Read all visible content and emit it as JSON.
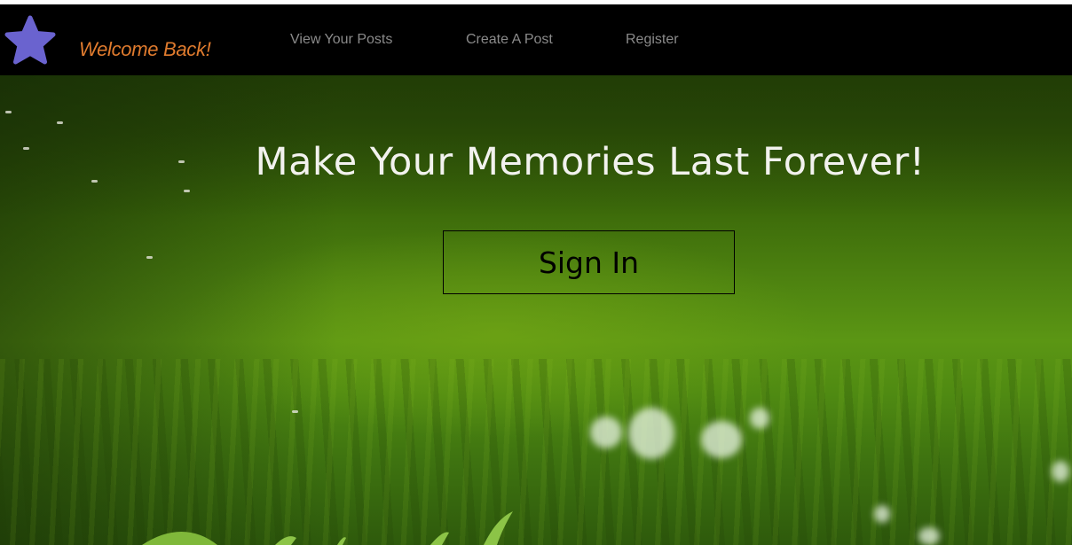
{
  "navbar": {
    "welcome_text": "Welcome Back!",
    "logo_icon": "star-icon",
    "links": [
      {
        "label": "View Your Posts"
      },
      {
        "label": "Create A Post"
      },
      {
        "label": "Register"
      }
    ]
  },
  "hero": {
    "headline": "Make Your Memories Last Forever!",
    "sign_in_label": "Sign In"
  },
  "colors": {
    "navbar_background": "#000000",
    "welcome_text": "#e07b2e",
    "nav_link": "#8a8a8a",
    "logo_star": "#6a63cf",
    "headline": "#f2f2ee",
    "button_border": "#000000"
  }
}
